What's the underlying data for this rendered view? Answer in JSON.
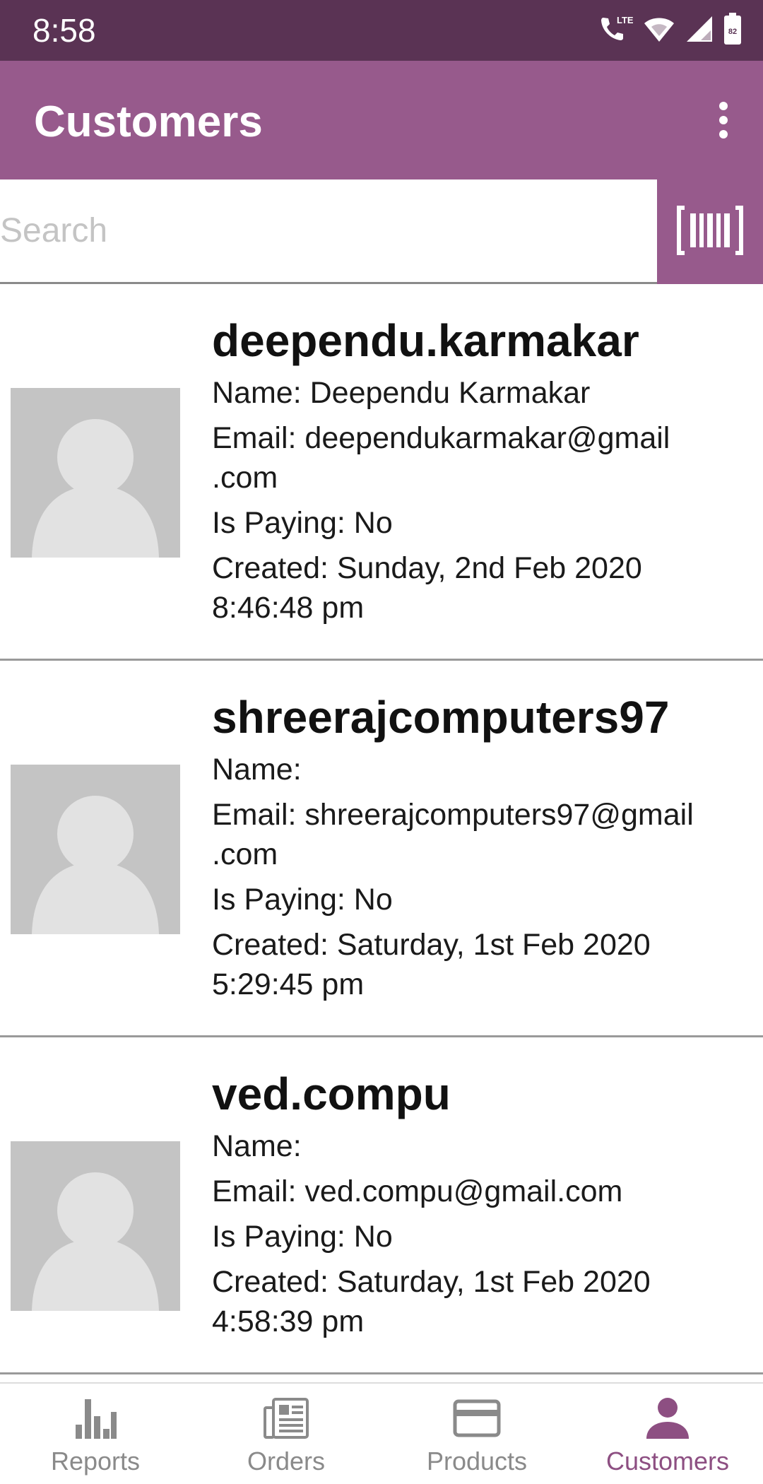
{
  "status_bar": {
    "time": "8:58",
    "battery_level": "82",
    "icons": [
      "volte-call-icon",
      "wifi-icon",
      "cell-signal-icon",
      "battery-icon"
    ]
  },
  "app_bar": {
    "title": "Customers",
    "menu_icon": "more-vert-icon"
  },
  "search": {
    "placeholder": "Search",
    "value": "",
    "barcode_icon": "barcode-scan-icon"
  },
  "colors": {
    "status_bar": "#5a3354",
    "primary": "#975a8c",
    "active_nav": "#8d4f82",
    "avatar_bg": "#c4c4c4"
  },
  "customers": [
    {
      "username": "deependu.karmakar",
      "name_label": "Name: Deependu Karmakar",
      "email_line1": "Email: deependukarmakar@gmail",
      "email_line2": ".com",
      "paying": "Is Paying: No",
      "created_line1": "Created: Sunday, 2nd Feb 2020",
      "created_line2": "8:46:48 pm"
    },
    {
      "username": "shreerajcomputers97",
      "name_label": "Name:",
      "email_line1": "Email: shreerajcomputers97@gmail",
      "email_line2": ".com",
      "paying": "Is Paying: No",
      "created_line1": "Created: Saturday, 1st Feb 2020",
      "created_line2": "5:29:45 pm"
    },
    {
      "username": "ved.compu",
      "name_label": "Name:",
      "email_line1": "Email: ved.compu@gmail.com",
      "email_line2": "",
      "paying": "Is Paying: No",
      "created_line1": "Created: Saturday, 1st Feb 2020",
      "created_line2": "4:58:39 pm"
    }
  ],
  "bottom_nav": [
    {
      "label": "Reports",
      "icon": "bar-chart-icon",
      "active": false
    },
    {
      "label": "Orders",
      "icon": "orders-icon",
      "active": false
    },
    {
      "label": "Products",
      "icon": "credit-card-icon",
      "active": false
    },
    {
      "label": "Customers",
      "icon": "person-icon",
      "active": true
    }
  ]
}
